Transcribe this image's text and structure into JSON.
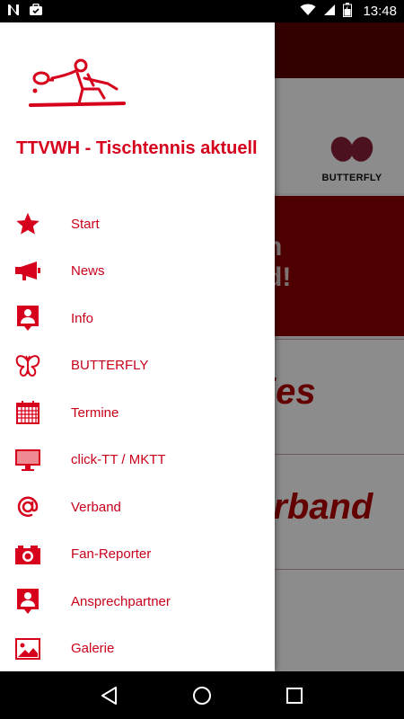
{
  "status_bar": {
    "time": "13:48",
    "icons": [
      "n-icon",
      "briefcase-icon",
      "wifi-icon",
      "signal-icon",
      "battery-icon"
    ]
  },
  "background": {
    "sponsor": "BUTTERFLY",
    "banner_lines": [
      "n",
      "d!"
    ],
    "tiles": [
      "ies",
      "erband"
    ]
  },
  "drawer": {
    "title": "TTVWH - Tischtennis aktuell",
    "items": [
      {
        "label": "Start",
        "icon": "star-icon"
      },
      {
        "label": "News",
        "icon": "megaphone-icon"
      },
      {
        "label": "Info",
        "icon": "contact-icon"
      },
      {
        "label": "BUTTERFLY",
        "icon": "butterfly-icon"
      },
      {
        "label": "Termine",
        "icon": "calendar-icon"
      },
      {
        "label": "click-TT / MKTT",
        "icon": "monitor-icon"
      },
      {
        "label": "Verband",
        "icon": "at-icon"
      },
      {
        "label": "Fan-Reporter",
        "icon": "camera-icon"
      },
      {
        "label": "Ansprechpartner",
        "icon": "contact-icon"
      },
      {
        "label": "Galerie",
        "icon": "image-icon"
      }
    ]
  },
  "colors": {
    "accent": "#d6001c",
    "toolbar": "#5e0000",
    "banner": "#8f0000"
  }
}
